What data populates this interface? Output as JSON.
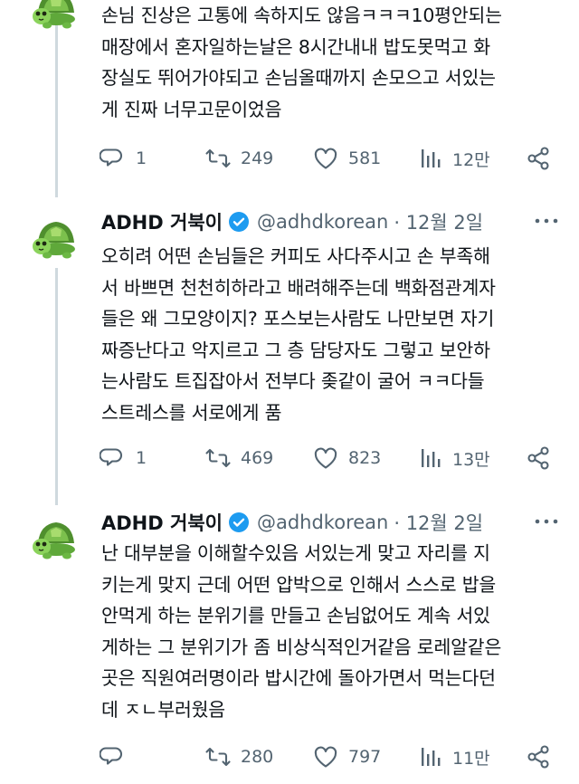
{
  "colors": {
    "text": "#0f1419",
    "muted": "#536471",
    "verified": "#1d9bf0",
    "thread_line": "#cfd9de"
  },
  "tweets": [
    {
      "text": "손님 진상은 고통에 속하지도 않음ㅋㅋㅋ10평안되는\n매장에서 혼자일하는날은 8시간내내 밥도못먹고 화\n장실도 뛰어가야되고 손님올때까지 손모으고 서있는\n게 진짜 너무고문이었음",
      "replies": "1",
      "retweets": "249",
      "likes": "581",
      "views": "12만"
    },
    {
      "name": "ADHD 거북이",
      "handle": "@adhdkorean",
      "date": "· 12월 2일",
      "text": "오히려 어떤 손님들은 커피도 사다주시고 손 부족해\n서 바쁘면 천천히하라고 배려해주는데 백화점관계자\n들은 왜 그모양이지? 포스보는사람도 나만보면 자기\n짜증난다고 악지르고 그 층 담당자도 그렇고 보안하\n는사람도 트집잡아서 전부다 좆같이 굴어 ㅋㅋ다들\n스트레스를 서로에게 품",
      "replies": "1",
      "retweets": "469",
      "likes": "823",
      "views": "13만"
    },
    {
      "name": "ADHD 거북이",
      "handle": "@adhdkorean",
      "date": "· 12월 2일",
      "text": "난 대부분을 이해할수있음 서있는게 맞고 자리를 지\n키는게 맞지 근데 어떤 압박으로 인해서 스스로 밥을\n안먹게 하는 분위기를 만들고 손님없어도 계속 서있\n게하는 그 분위기가 좀 비상식적인거같음 로레알같은\n곳은 직원여러명이라 밥시간에 돌아가면서 먹는다던\n데 ㅈㄴ부러웠음",
      "replies": "",
      "retweets": "280",
      "likes": "797",
      "views": "11만"
    }
  ]
}
